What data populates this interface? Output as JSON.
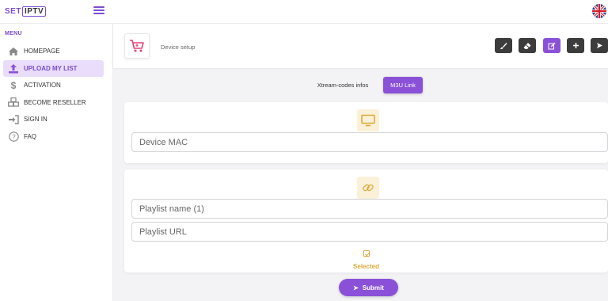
{
  "brand": {
    "part1": "SET",
    "part2": "IPTV"
  },
  "colors": {
    "accent": "#8a51d8",
    "gold": "#e0a93a",
    "dark_button": "#3c3c3c"
  },
  "sidebar": {
    "menu_title": "MENU",
    "items": [
      {
        "label": "HOMEPAGE",
        "icon": "home-icon"
      },
      {
        "label": "UPLOAD MY LIST",
        "icon": "upload-icon",
        "active": true
      },
      {
        "label": "ACTIVATION",
        "icon": "dollar-icon"
      },
      {
        "label": "BECOME RESELLER",
        "icon": "boxes-icon"
      },
      {
        "label": "SIGN IN",
        "icon": "sign-in-icon"
      },
      {
        "label": "FAQ",
        "icon": "question-icon"
      }
    ]
  },
  "header": {
    "title": "Device setup"
  },
  "toolbar": [
    "brush-icon",
    "eraser-icon",
    "edit-icon",
    "plus-icon",
    "send-icon"
  ],
  "tabs": {
    "xtream": "Xtream-codes infos",
    "m3u": "M3U Link"
  },
  "form": {
    "device_mac_placeholder": "Device MAC",
    "playlist_name_placeholder": "Playlist name (1)",
    "playlist_url_placeholder": "Playlist URL",
    "selected_label": "Selected",
    "submit_label": "Submit"
  }
}
